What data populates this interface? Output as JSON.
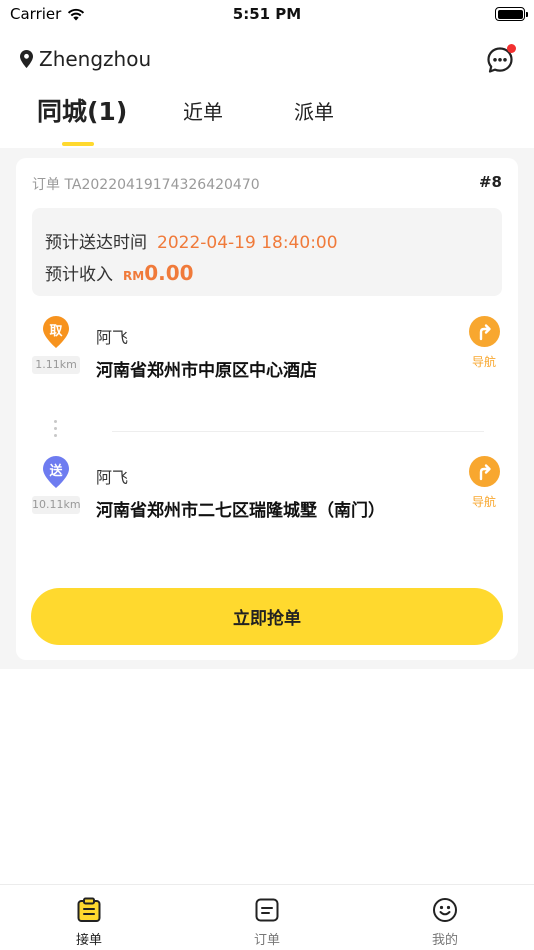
{
  "status_bar": {
    "carrier": "Carrier",
    "time": "5:51 PM"
  },
  "header": {
    "city": "Zhengzhou"
  },
  "tabs": [
    {
      "label": "同城(1)",
      "active": true
    },
    {
      "label": "近单",
      "active": false
    },
    {
      "label": "派单",
      "active": false
    }
  ],
  "order": {
    "number": "订单 TA20220419174326420470",
    "index": "#8",
    "eta_label": "预计送达时间",
    "eta_value": "2022-04-19 18:40:00",
    "income_label": "预计收入",
    "income_currency": "RM",
    "income_amount": "0.00",
    "pickup": {
      "tag": "取",
      "distance": "1.11km",
      "name": "阿飞",
      "address": "河南省郑州市中原区中心酒店",
      "nav_label": "导航",
      "color": "#f7931e"
    },
    "delivery": {
      "tag": "送",
      "distance": "10.11km",
      "name": "阿飞",
      "address": "河南省郑州市二七区瑞隆城墅（南门）",
      "nav_label": "导航",
      "color": "#6e7cf0"
    },
    "grab_button": "立即抢单"
  },
  "tabbar": [
    {
      "label": "接单",
      "icon": "clipboard-icon",
      "active": true
    },
    {
      "label": "订单",
      "icon": "order-list-icon",
      "active": false
    },
    {
      "label": "我的",
      "icon": "smiley-icon",
      "active": false
    }
  ],
  "colors": {
    "accent": "#ffd92e",
    "orange": "#f07a3a",
    "nav": "#f8a72f"
  }
}
